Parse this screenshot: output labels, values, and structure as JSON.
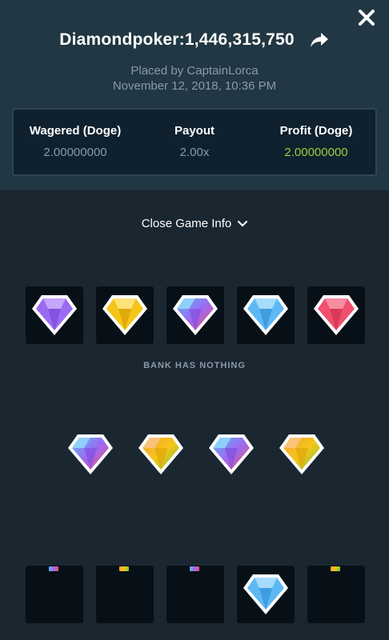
{
  "game": {
    "title": "Diamondpoker:1,446,315,750",
    "placed_by": "Placed by CaptainLorca",
    "date": "November 12, 2018, 10:36 PM"
  },
  "stats": {
    "wagered_label": "Wagered (Doge)",
    "wagered_value": "2.00000000",
    "payout_label": "Payout",
    "payout_value": "2.00x",
    "profit_label": "Profit (Doge)",
    "profit_value": "2.00000000"
  },
  "toggle_label": "Close Game Info",
  "bank_text": "BANK HAS NOTHING",
  "colors": {
    "purple": "#9b6bf2",
    "yellow": "#f5c518",
    "blue": "#5db8f5",
    "red": "#f0506e",
    "green": "#9ace3f",
    "orange": "#f7a23b"
  },
  "dealer_gems": [
    "purple-gem-icon",
    "yellow-gem-icon",
    "multicolor-gem-icon",
    "blue-gem-icon",
    "red-gem-icon"
  ],
  "hand_gems": [
    "blue-purple-red-gem-icon",
    "orange-yellow-green-gem-icon",
    "blue-purple-red-gem-icon",
    "orange-yellow-green-gem-icon"
  ],
  "bottom_tiles": [
    "empty",
    "empty",
    "empty",
    "blue-gem-icon",
    "empty"
  ]
}
